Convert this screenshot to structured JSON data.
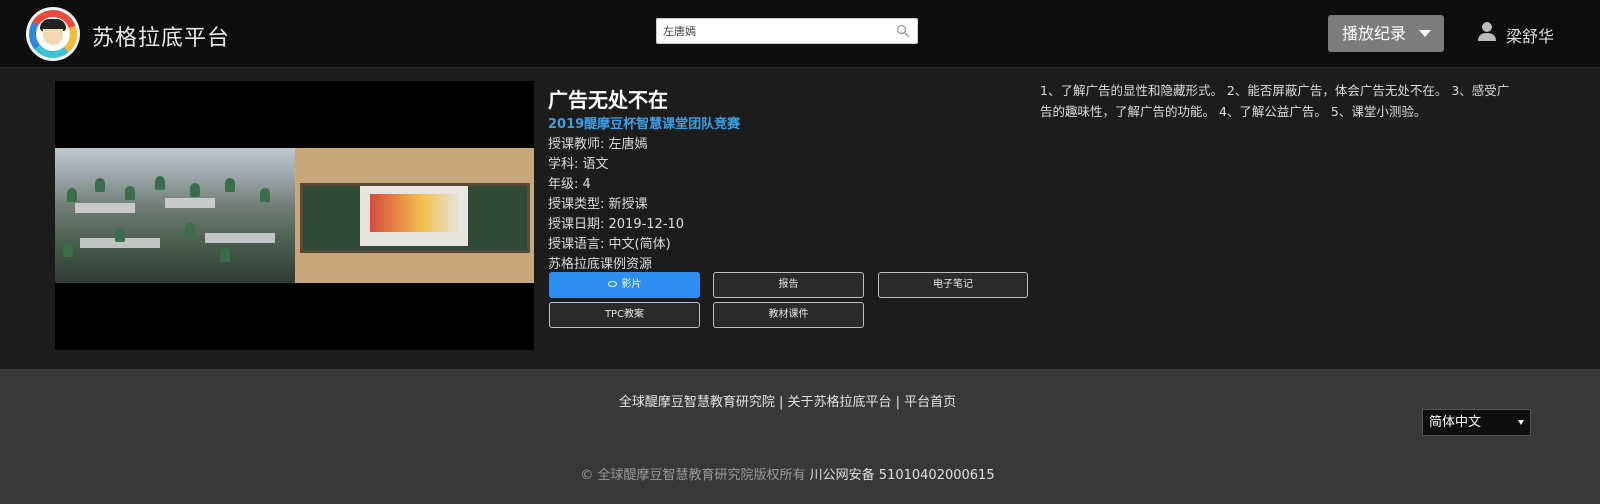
{
  "header": {
    "brand": "苏格拉底平台",
    "search_value": "左唐嫣",
    "history_button": "播放纪录",
    "user_name": "梁舒华"
  },
  "lesson": {
    "title": "广告无处不在",
    "competition": "2019醍摩豆杯智慧课堂团队竞赛",
    "teacher": "授课教师: 左唐嫣",
    "subject": "学科: 语文",
    "grade": "年级: 4",
    "type": "授课类型: 新授课",
    "date": "授课日期: 2019-12-10",
    "language": "授课语言: 中文(简体)",
    "resource": "苏格拉底课例资源",
    "description": "1、了解广告的显性和隐藏形式。 2、能否屏蔽广告，体会广告无处不在。 3、感受广告的趣味性，了解广告的功能。 4、了解公益广告。 5、课堂小测验。"
  },
  "buttons": {
    "video": "影片",
    "report": "报告",
    "notes": "电子笔记",
    "tpc": "TPC教案",
    "materials": "教材课件"
  },
  "footer": {
    "link1": "全球醍摩豆智慧教育研究院",
    "sep1": " | ",
    "link2": "关于苏格拉底平台",
    "sep2": " | ",
    "link3": "平台首页",
    "language_select": "简体中文",
    "copyright": "© 全球醍摩豆智慧教育研究院版权所有",
    "icp": "川公网安备 51010402000615"
  },
  "colors": {
    "accent": "#2f8ef0",
    "link": "#3aa0e8"
  }
}
